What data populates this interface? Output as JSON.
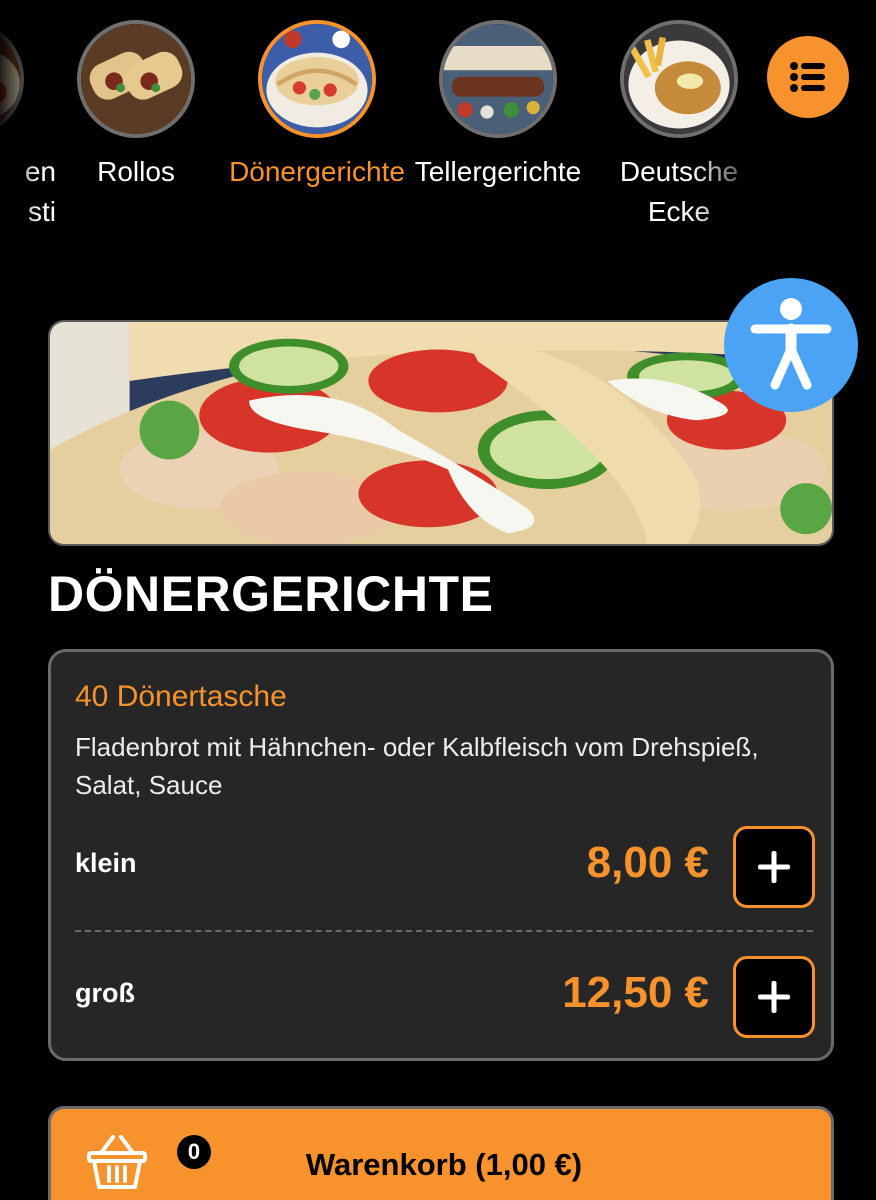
{
  "categories": [
    {
      "label_line1": "en",
      "label_line2": "sti",
      "icon": "food-photo",
      "active": false
    },
    {
      "label_line1": "Rollos",
      "label_line2": "",
      "icon": "wraps-photo",
      "active": false
    },
    {
      "label_line1": "Dönergerichte",
      "label_line2": "",
      "icon": "doner-plate-photo",
      "active": true
    },
    {
      "label_line1": "Tellergerichte",
      "label_line2": "",
      "icon": "grill-plate-photo",
      "active": false
    },
    {
      "label_line1": "Deutsche",
      "label_line2": "Ecke",
      "icon": "schnitzel-photo",
      "active": false
    }
  ],
  "menu_button_icon": "list-icon",
  "accessibility_icon": "accessibility-person-icon",
  "section": {
    "title": "DÖNERGERICHTE",
    "hero_image": "doner-pita-photo"
  },
  "product": {
    "name": "40 Dönertasche",
    "description": "Fladenbrot mit Hähnchen- oder Kalbfleisch vom Drehspieß, Salat, Sauce",
    "sizes": [
      {
        "label": "klein",
        "price": "8,00 €",
        "button": "+"
      },
      {
        "label": "groß",
        "price": "12,50 €",
        "button": "+"
      }
    ]
  },
  "cart": {
    "count": "0",
    "label": "Warenkorb (1,00 €)",
    "icon": "basket-icon"
  },
  "colors": {
    "accent": "#f7922c",
    "background": "#000000",
    "card": "#262626",
    "accessibility": "#4aa3f5"
  }
}
